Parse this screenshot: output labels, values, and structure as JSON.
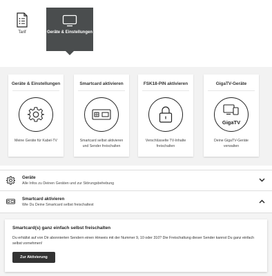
{
  "nav": {
    "tarif_label": "Tarif",
    "geraete_label": "Geräte & Einstellungen"
  },
  "cards": [
    {
      "title": "Geräte & Einstellungen",
      "desc": "Meine Geräte für Kabel-TV",
      "icon": "gear-icon"
    },
    {
      "title": "Smartcard aktivieren",
      "desc": "Smartcard selbst aktivieren und Sender freischalten",
      "icon": "smartcard-icon"
    },
    {
      "title": "FSK18-PIN aktivieren",
      "desc": "Verschlüsselte TV-Inhalte freischalten",
      "icon": "lock-icon"
    },
    {
      "title": "GigaTV-Geräte",
      "desc": "Deine GigaTV-Geräte verwalten",
      "icon": "gigatv-icon",
      "badge": "GigaTV"
    }
  ],
  "accordions": [
    {
      "title": "Geräte",
      "subtitle": "Alle Infos zu Deinen Geräten und zur Störungsbehebung",
      "icon": "gear-icon",
      "chevron": "chevron-down-icon"
    },
    {
      "title": "Smartcard aktivieren",
      "subtitle": "Wie Du Deine Smartcard selbst freischaltest",
      "icon": "smartcard-icon",
      "chevron": "chevron-up-icon"
    }
  ],
  "panel": {
    "title": "Smartcard(s) ganz einfach selbst freischalten",
    "text": "Du erhältst auf von Dir abonnierten Sendern einen Hinweis mit der Nummer 9, 10 oder 310? Die Freischaltung dieser Sender kannst Du ganz einfach selbst vornehmen!",
    "button": "Zur Aktivierung"
  },
  "colors": {
    "tab_active": "#4a4d4e",
    "band": "#f2f2f2",
    "button": "#333333"
  }
}
